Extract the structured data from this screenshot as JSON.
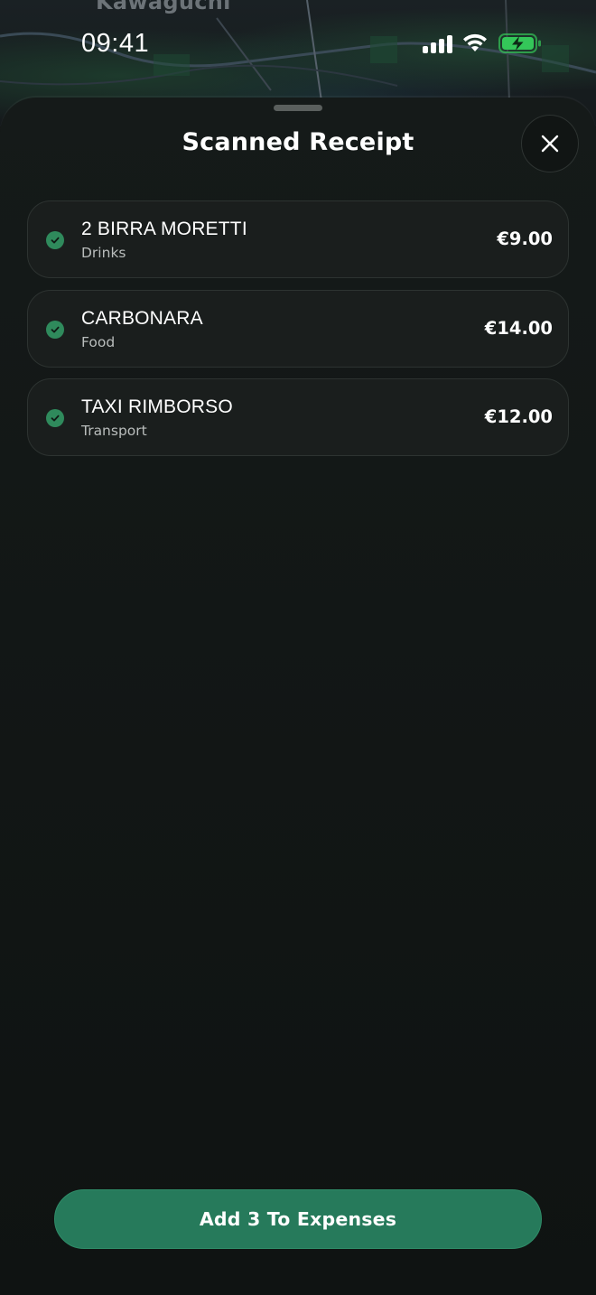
{
  "status_bar": {
    "time": "09:41"
  },
  "map": {
    "city_label": "Kawaguchi"
  },
  "sheet": {
    "title": "Scanned Receipt",
    "close_icon": "close-icon"
  },
  "items": [
    {
      "name": "2 BIRRA MORETTI",
      "category": "Drinks",
      "amount": "€9.00",
      "checked": true
    },
    {
      "name": "CARBONARA",
      "category": "Food",
      "amount": "€14.00",
      "checked": true
    },
    {
      "name": "TAXI RIMBORSO",
      "category": "Transport",
      "amount": "€12.00",
      "checked": true
    }
  ],
  "action": {
    "add_label": "Add 3 To Expenses"
  },
  "colors": {
    "accent": "#267a5b",
    "check": "#2f8a5c",
    "battery": "#34c759",
    "sheet": "#141918"
  }
}
